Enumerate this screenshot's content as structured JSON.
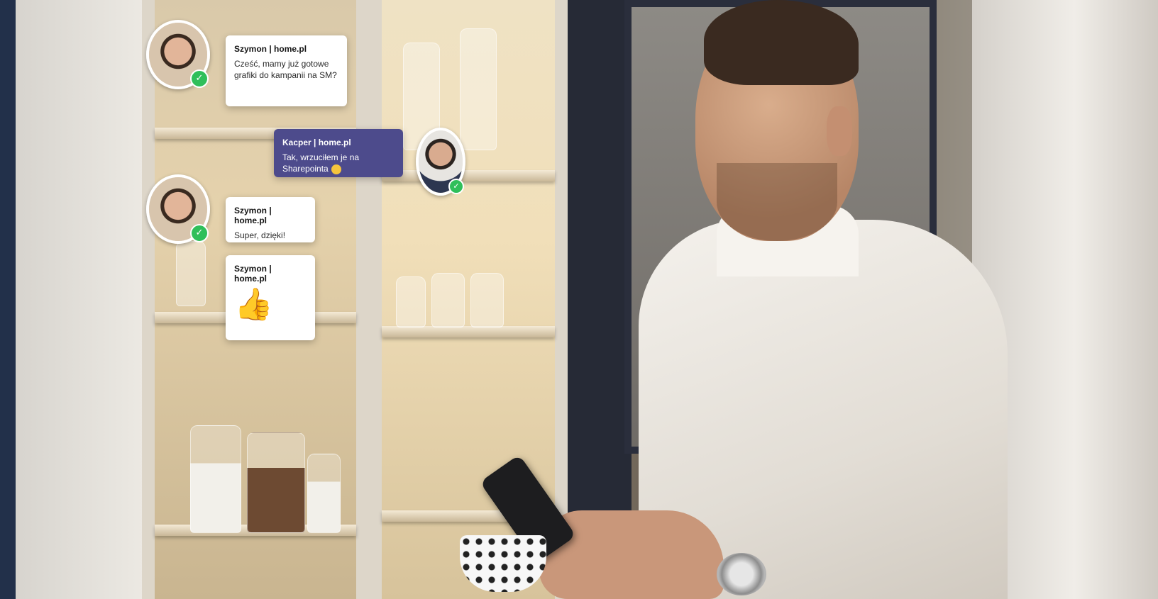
{
  "chat": {
    "messages": [
      {
        "sender": "Szymon | home.pl",
        "text": "Cześć, mamy już gotowe grafiki do kampanii na SM?"
      },
      {
        "sender": "Kacper | home.pl",
        "text": "Tak, wrzuciłem je na Sharepointa"
      },
      {
        "sender": "Szymon | home.pl",
        "text": "Super, dzięki!"
      },
      {
        "sender": "Szymon | home.pl",
        "text": ""
      }
    ],
    "icons": {
      "verified": "check-icon",
      "smile": "smile-emoji-icon",
      "thumbs_up": "thumbs-up-emoji-icon"
    }
  },
  "colors": {
    "outgoing_bubble": "#4d4b8c",
    "incoming_bubble": "#ffffff",
    "verified_badge": "#2fbf5a"
  }
}
